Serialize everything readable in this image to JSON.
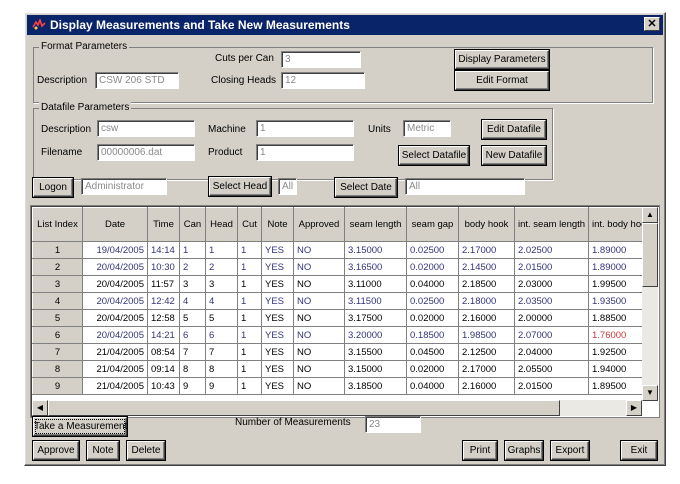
{
  "window": {
    "title": "Display Measurements and Take New Measurements",
    "close_glyph": "✕"
  },
  "format": {
    "group_title": "Format Parameters",
    "cuts_label": "Cuts per Can",
    "cuts_value": "3",
    "description_label": "Description",
    "description_value": "CSW 206 STD",
    "heads_label": "Closing Heads",
    "heads_value": "12",
    "display_params_btn": "Display Parameters",
    "edit_format_btn": "Edit Format"
  },
  "datafile": {
    "group_title": "Datafile Parameters",
    "description_label": "Description",
    "description_value": "csw",
    "machine_label": "Machine",
    "machine_value": "1",
    "units_label": "Units",
    "units_value": "Metric",
    "edit_btn": "Edit Datafile",
    "filename_label": "Filename",
    "filename_value": "00000006.dat",
    "product_label": "Product",
    "product_value": "1",
    "select_btn": "Select Datafile",
    "new_btn": "New Datafile"
  },
  "filters": {
    "logon_btn": "Logon",
    "logon_value": "Administrator",
    "select_head_btn": "Select Head",
    "head_value": "All",
    "select_date_btn": "Select Date",
    "date_value": "All"
  },
  "table": {
    "columns": [
      "List Index",
      "Date",
      "Time",
      "Can",
      "Head",
      "Cut",
      "Note",
      "Approved",
      "seam length",
      "seam gap",
      "body hook",
      "int. seam length",
      "int. body hoo"
    ],
    "rows": [
      {
        "cells": [
          "1",
          "19/04/2005",
          "14:14",
          "1",
          "1",
          "1",
          "YES",
          "NO",
          "3.15000",
          "0.02500",
          "2.17000",
          "2.02500",
          "1.89000"
        ],
        "color": "#33337a"
      },
      {
        "cells": [
          "2",
          "20/04/2005",
          "10:30",
          "2",
          "2",
          "1",
          "YES",
          "NO",
          "3.16500",
          "0.02000",
          "2.14500",
          "2.01500",
          "1.89000"
        ],
        "color": "#33337a"
      },
      {
        "cells": [
          "3",
          "20/04/2005",
          "11:57",
          "3",
          "3",
          "1",
          "YES",
          "NO",
          "3.11000",
          "0.04000",
          "2.18500",
          "2.03000",
          "1.99500"
        ],
        "color": "#000000"
      },
      {
        "cells": [
          "4",
          "20/04/2005",
          "12:42",
          "4",
          "4",
          "1",
          "YES",
          "NO",
          "3.11500",
          "0.02500",
          "2.18000",
          "2.03500",
          "1.93500"
        ],
        "color": "#33337a"
      },
      {
        "cells": [
          "5",
          "20/04/2005",
          "12:58",
          "5",
          "5",
          "1",
          "YES",
          "NO",
          "3.17500",
          "0.02000",
          "2.16000",
          "2.00000",
          "1.88500"
        ],
        "color": "#000000"
      },
      {
        "cells": [
          "6",
          "20/04/2005",
          "14:21",
          "6",
          "6",
          "1",
          "YES",
          "NO",
          "3.20000",
          "0.18500",
          "1.98500",
          "2.07000",
          "1.76000"
        ],
        "color": "#33337a",
        "last_color": "#c83a3a"
      },
      {
        "cells": [
          "7",
          "21/04/2005",
          "08:54",
          "7",
          "7",
          "1",
          "YES",
          "NO",
          "3.15500",
          "0.04500",
          "2.12500",
          "2.04000",
          "1.92500"
        ],
        "color": "#000000"
      },
      {
        "cells": [
          "8",
          "21/04/2005",
          "09:14",
          "8",
          "8",
          "1",
          "YES",
          "NO",
          "3.15000",
          "0.02000",
          "2.17000",
          "2.05500",
          "1.94000"
        ],
        "color": "#000000"
      },
      {
        "cells": [
          "9",
          "21/04/2005",
          "10:43",
          "9",
          "9",
          "1",
          "YES",
          "NO",
          "3.18500",
          "0.04000",
          "2.16000",
          "2.01500",
          "1.89500"
        ],
        "color": "#000000"
      }
    ]
  },
  "bottom": {
    "take_btn": "Take a Measurement",
    "count_label": "Number of Measurements",
    "count_value": "23",
    "approve_btn": "Approve",
    "note_btn": "Note",
    "delete_btn": "Delete",
    "print_btn": "Print",
    "graphs_btn": "Graphs",
    "export_btn": "Export",
    "exit_btn": "Exit"
  },
  "icons": {
    "app": "app-icon",
    "close": "close-icon",
    "up": "scroll-up-icon",
    "down": "scroll-down-icon",
    "left": "scroll-left-icon",
    "right": "scroll-right-icon"
  }
}
